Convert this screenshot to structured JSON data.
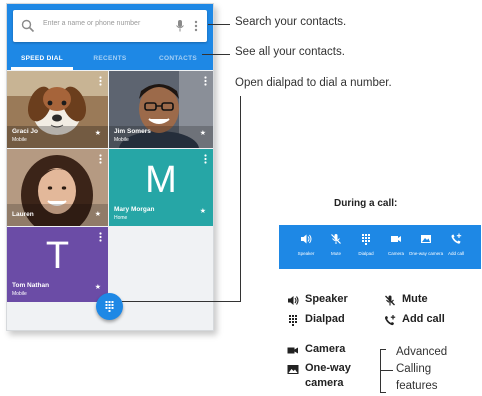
{
  "search": {
    "placeholder": "Enter a name or phone number"
  },
  "tabs": [
    {
      "label": "SPEED DIAL"
    },
    {
      "label": "RECENTS"
    },
    {
      "label": "CONTACTS"
    }
  ],
  "speed_dial": [
    {
      "name": "Graci Jo",
      "type": "Mobile"
    },
    {
      "name": "Jim Somers",
      "type": "Mobile"
    },
    {
      "name": "Lauren",
      "type": ""
    },
    {
      "name": "Mary Morgan",
      "type": "Home",
      "initial": "M"
    },
    {
      "name": "Tom Nathan",
      "type": "Mobile",
      "initial": "T"
    }
  ],
  "callouts": {
    "search": "Search your contacts.",
    "contacts": "See all your contacts.",
    "dialpad": "Open dialpad to dial a number."
  },
  "during_call": {
    "title": "During a call:",
    "buttons": [
      {
        "label": "Speaker",
        "icon": "speaker-icon"
      },
      {
        "label": "Mute",
        "icon": "mute-icon"
      },
      {
        "label": "Dialpad",
        "icon": "dialpad-icon"
      },
      {
        "label": "Camera",
        "icon": "camera-icon"
      },
      {
        "label": "One-way camera",
        "icon": "one-way-camera-icon"
      },
      {
        "label": "Add call",
        "icon": "add-call-icon"
      }
    ]
  },
  "legend": {
    "speaker": "Speaker",
    "mute": "Mute",
    "dialpad": "Dialpad",
    "add_call": "Add call",
    "camera": "Camera",
    "one_way_camera_1": "One-way",
    "one_way_camera_2": "camera",
    "advanced_1": "Advanced",
    "advanced_2": "Calling",
    "advanced_3": "features"
  },
  "colors": {
    "accent": "#1e88e5",
    "teal_tile": "#26a6a6",
    "purple_tile": "#6b4ca6"
  }
}
